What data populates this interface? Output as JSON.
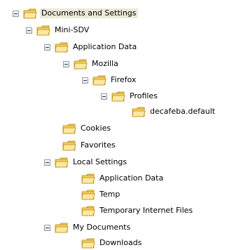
{
  "tree": {
    "root": {
      "label": "Documents and Settings",
      "expanded": true
    },
    "mini_sdv": {
      "label": "Mini-SDV",
      "expanded": true
    },
    "application_data": {
      "label": "Application Data",
      "expanded": true
    },
    "mozilla": {
      "label": "Mozilla",
      "expanded": true
    },
    "firefox": {
      "label": "Firefox",
      "expanded": true
    },
    "profiles": {
      "label": "Profiles",
      "expanded": true
    },
    "profile_default": {
      "label": "decafeba.default"
    },
    "cookies": {
      "label": "Cookies"
    },
    "favorites": {
      "label": "Favorites"
    },
    "local_settings": {
      "label": "Local Settings",
      "expanded": true
    },
    "ls_application_data": {
      "label": "Application Data"
    },
    "temp": {
      "label": "Temp"
    },
    "temporary_internet_files": {
      "label": "Temporary Internet Files"
    },
    "my_documents": {
      "label": "My Documents",
      "expanded": true
    },
    "downloads": {
      "label": "Downloads"
    }
  },
  "colors": {
    "folder_fill": "#f6d36b",
    "folder_edge": "#c79a2a",
    "expander_border": "#919b9c",
    "selection_bg": "#ece9d8"
  },
  "icons": {
    "folder": "folder-open-icon",
    "expander": "collapse-icon"
  }
}
